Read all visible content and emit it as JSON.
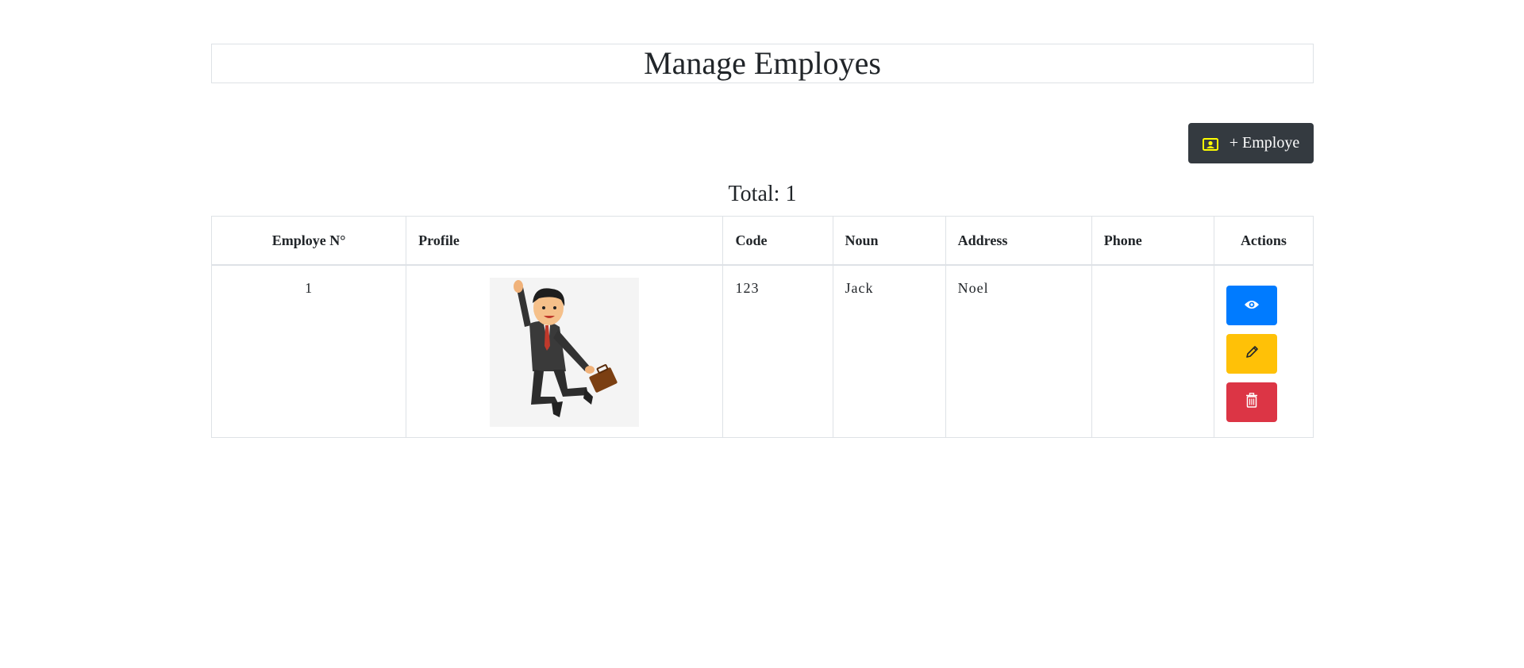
{
  "page": {
    "title": "Manage Employes"
  },
  "toolbar": {
    "add_label": "+ Employe",
    "add_icon": "person-badge-icon"
  },
  "summary": {
    "total_text": "Total: 1"
  },
  "table": {
    "columns": [
      "Employe N°",
      "Profile",
      "Code",
      "Noun",
      "Address",
      "Phone",
      "Actions"
    ],
    "rows": [
      {
        "number": "1",
        "profile_image": "businessman-jumping-illustration",
        "code": "123",
        "noun": "Jack",
        "address": "Noel",
        "phone": "",
        "actions": [
          "eye-icon",
          "pencil-icon",
          "trash-icon"
        ]
      }
    ]
  },
  "colors": {
    "view": "#007bff",
    "edit": "#ffc107",
    "delete": "#dc3545",
    "dark": "#343a40",
    "icon_accent": "#ffff00"
  }
}
